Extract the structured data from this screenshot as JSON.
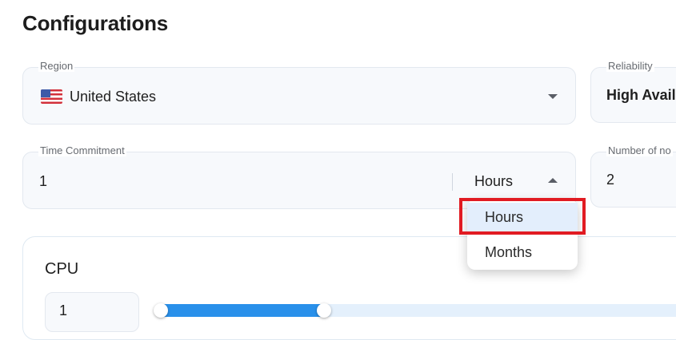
{
  "page": {
    "title": "Configurations"
  },
  "region": {
    "label": "Region",
    "value": "United States",
    "flag_icon": "us-flag-icon"
  },
  "reliability": {
    "label": "Reliability",
    "value": "High Avail"
  },
  "time_commitment": {
    "label": "Time Commitment",
    "value": "1",
    "unit": "Hours"
  },
  "nodes": {
    "label": "Number of no",
    "value": "2"
  },
  "unit_menu": {
    "options": [
      "Hours",
      "Months"
    ],
    "selected": "Hours",
    "highlight_color": "#e11b22"
  },
  "cpu": {
    "title": "CPU",
    "value": "1",
    "slider": {
      "accent": "#2990ea",
      "track": "#e4f0fc"
    }
  }
}
